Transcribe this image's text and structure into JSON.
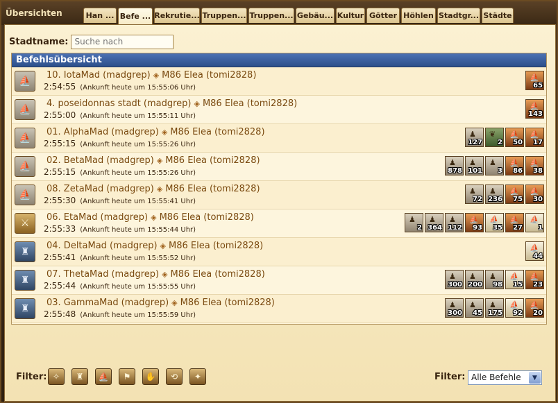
{
  "window": {
    "title": "Übersichten"
  },
  "tabs": [
    "Han ...",
    "Befe ...",
    "Rekrutie...",
    "Truppen...",
    "Truppen...",
    "Gebäu...",
    "Kultur",
    "Götter",
    "Höhlen",
    "Stadtgr...",
    "Städte"
  ],
  "active_tab_index": 1,
  "search": {
    "label": "Stadtname:",
    "placeholder": "Suche nach"
  },
  "panel": {
    "title": "Befehlsübersicht"
  },
  "commands": [
    {
      "type": "ship",
      "title": "10. IotaMad",
      "owner": "(madgrep)",
      "target": "M86 Elea",
      "target_owner": "(tomi2828)",
      "time": "2:54:55",
      "arrival": "(Ankunft heute um 15:55:06 Uhr)",
      "units": [
        {
          "kind": "fire",
          "count": "65"
        }
      ]
    },
    {
      "type": "ship",
      "title": "4. poseidonnas stadt",
      "owner": "(madgrep)",
      "target": "M86 Elea",
      "target_owner": "(tomi2828)",
      "time": "2:55:00",
      "arrival": "(Ankunft heute um 15:55:11 Uhr)",
      "units": [
        {
          "kind": "fire",
          "count": "143"
        }
      ]
    },
    {
      "type": "ship",
      "title": "01. AlphaMad",
      "owner": "(madgrep)",
      "target": "M86 Elea",
      "target_owner": "(tomi2828)",
      "time": "2:55:15",
      "arrival": "(Ankunft heute um 15:55:26 Uhr)",
      "units": [
        {
          "kind": "unit",
          "count": "127"
        },
        {
          "kind": "myth",
          "count": "2"
        },
        {
          "kind": "fire",
          "count": "50"
        },
        {
          "kind": "fire",
          "count": "17"
        }
      ]
    },
    {
      "type": "ship",
      "title": "02. BetaMad",
      "owner": "(madgrep)",
      "target": "M86 Elea",
      "target_owner": "(tomi2828)",
      "time": "2:55:15",
      "arrival": "(Ankunft heute um 15:55:26 Uhr)",
      "units": [
        {
          "kind": "unit",
          "count": "878"
        },
        {
          "kind": "unit",
          "count": "101"
        },
        {
          "kind": "unit",
          "count": "3"
        },
        {
          "kind": "fire",
          "count": "86"
        },
        {
          "kind": "fire",
          "count": "38"
        }
      ]
    },
    {
      "type": "ship",
      "title": "08. ZetaMad",
      "owner": "(madgrep)",
      "target": "M86 Elea",
      "target_owner": "(tomi2828)",
      "time": "2:55:30",
      "arrival": "(Ankunft heute um 15:55:41 Uhr)",
      "units": [
        {
          "kind": "unit",
          "count": "72"
        },
        {
          "kind": "unit",
          "count": "236"
        },
        {
          "kind": "fire",
          "count": "75"
        },
        {
          "kind": "fire",
          "count": "30"
        }
      ]
    },
    {
      "type": "attack",
      "title": "06. EtaMad",
      "owner": "(madgrep)",
      "target": "M86 Elea",
      "target_owner": "(tomi2828)",
      "time": "2:55:33",
      "arrival": "(Ankunft heute um 15:55:44 Uhr)",
      "units": [
        {
          "kind": "unit",
          "count": "2"
        },
        {
          "kind": "unit",
          "count": "364"
        },
        {
          "kind": "unit",
          "count": "112"
        },
        {
          "kind": "fire",
          "count": "93"
        },
        {
          "kind": "light",
          "count": "35"
        },
        {
          "kind": "fire",
          "count": "27"
        },
        {
          "kind": "light",
          "count": "1"
        }
      ]
    },
    {
      "type": "land",
      "title": "04. DeltaMad",
      "owner": "(madgrep)",
      "target": "M86 Elea",
      "target_owner": "(tomi2828)",
      "time": "2:55:41",
      "arrival": "(Ankunft heute um 15:55:52 Uhr)",
      "units": [
        {
          "kind": "light",
          "count": "44"
        }
      ]
    },
    {
      "type": "land",
      "title": "07. ThetaMad",
      "owner": "(madgrep)",
      "target": "M86 Elea",
      "target_owner": "(tomi2828)",
      "time": "2:55:44",
      "arrival": "(Ankunft heute um 15:55:55 Uhr)",
      "units": [
        {
          "kind": "unit",
          "count": "300"
        },
        {
          "kind": "unit",
          "count": "200"
        },
        {
          "kind": "unit",
          "count": "98"
        },
        {
          "kind": "light",
          "count": "15"
        },
        {
          "kind": "fire",
          "count": "23"
        }
      ]
    },
    {
      "type": "land",
      "title": "03. GammaMad",
      "owner": "(madgrep)",
      "target": "M86 Elea",
      "target_owner": "(tomi2828)",
      "time": "2:55:48",
      "arrival": "(Ankunft heute um 15:55:59 Uhr)",
      "units": [
        {
          "kind": "unit",
          "count": "300"
        },
        {
          "kind": "unit",
          "count": "45"
        },
        {
          "kind": "unit",
          "count": "175"
        },
        {
          "kind": "light",
          "count": "92"
        },
        {
          "kind": "fire",
          "count": "20"
        }
      ]
    }
  ],
  "footer": {
    "filter_label": "Filter:",
    "filter_icons": [
      "attack-ship-icon",
      "land-units-icon",
      "ship-icon",
      "support-icon",
      "revolt-icon",
      "spy-icon",
      "myth-icon"
    ],
    "filter_right_label": "Filter:",
    "select_value": "Alle Befehle"
  }
}
